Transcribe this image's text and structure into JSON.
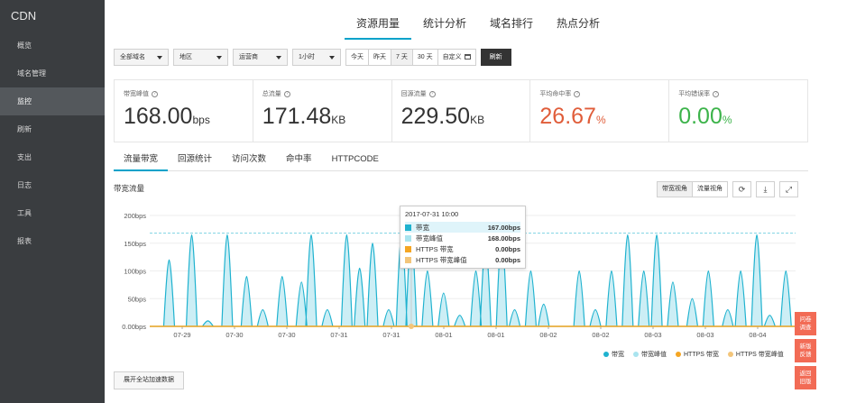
{
  "sidebar": {
    "title": "CDN",
    "items": [
      {
        "label": "概览"
      },
      {
        "label": "域名管理"
      },
      {
        "label": "监控"
      },
      {
        "label": "刷新"
      },
      {
        "label": "支出"
      },
      {
        "label": "日志"
      },
      {
        "label": "工具"
      },
      {
        "label": "报表"
      }
    ]
  },
  "topnav": [
    "资源用量",
    "统计分析",
    "域名排行",
    "热点分析"
  ],
  "filters": {
    "domain": "全部域名",
    "region": "地区",
    "isp": "运营商",
    "interval": "1小时",
    "ranges": [
      "今天",
      "昨天",
      "7 天",
      "30 天",
      "自定义"
    ],
    "refresh": "刷新"
  },
  "stats": [
    {
      "label": "带宽峰值",
      "value": "168.00",
      "unit": "bps"
    },
    {
      "label": "总流量",
      "value": "171.48",
      "unit": "KB"
    },
    {
      "label": "回源流量",
      "value": "229.50",
      "unit": "KB"
    },
    {
      "label": "平均命中率",
      "value": "26.67",
      "unit": "%"
    },
    {
      "label": "平均错误率",
      "value": "0.00",
      "unit": "%"
    }
  ],
  "subtabs": [
    "流量带宽",
    "回源统计",
    "访问次数",
    "命中率",
    "HTTPCODE"
  ],
  "chart_title": "带宽流量",
  "view_buttons": [
    "带宽视角",
    "流量视角"
  ],
  "icon_buttons": [
    "refresh-icon",
    "download-icon",
    "fullscreen-icon"
  ],
  "tooltip": {
    "time": "2017-07-31 10:00",
    "rows": [
      {
        "name": "带宽",
        "value": "167.00bps",
        "color": "#1fb2cf"
      },
      {
        "name": "带宽峰值",
        "value": "168.00bps",
        "color": "#a9e4ef"
      },
      {
        "name": "HTTPS 带宽",
        "value": "0.00bps",
        "color": "#f5a623"
      },
      {
        "name": "HTTPS 带宽峰值",
        "value": "0.00bps",
        "color": "#f3c57a"
      }
    ]
  },
  "expand_button": "展开全站加速数据",
  "side_buttons": [
    {
      "line1": "问卷",
      "line2": "调查"
    },
    {
      "line1": "新版",
      "line2": "反馈"
    },
    {
      "line1": "返回",
      "line2": "旧版"
    }
  ],
  "chart_data": {
    "type": "area",
    "y_ticks": [
      "200bps",
      "150bps",
      "100bps",
      "50bps",
      "0.00bps"
    ],
    "ylim": [
      0,
      200
    ],
    "x_ticks": [
      "07-29",
      "07-30",
      "07-30",
      "07-31",
      "07-31",
      "08-01",
      "08-01",
      "08-02",
      "08-02",
      "08-03",
      "08-03",
      "08-04"
    ],
    "series": [
      {
        "name": "带宽",
        "color": "#1fb2cf",
        "values": [
          0,
          0,
          0,
          0,
          0,
          0,
          0,
          0,
          0,
          0,
          0,
          0,
          0,
          10,
          165,
          20,
          0,
          0,
          0,
          0,
          0,
          0,
          166,
          35,
          0,
          0,
          0,
          0,
          0,
          0,
          20,
          0,
          0,
          0,
          0,
          0,
          0,
          0,
          0,
          0,
          0,
          0,
          0,
          0,
          95,
          0,
          0,
          0,
          0,
          0,
          0,
          30,
          0,
          0,
          0,
          0,
          0,
          0,
          0,
          0,
          0,
          0,
          0,
          0,
          0,
          0,
          0,
          0,
          0,
          0,
          0,
          0,
          165,
          20,
          0,
          0,
          0,
          0,
          0,
          0,
          0,
          0,
          0,
          0,
          0,
          0,
          0,
          0,
          0,
          0,
          55,
          0,
          0,
          0,
          0,
          0,
          0,
          0,
          0,
          0,
          0,
          0,
          0,
          0,
          0,
          0,
          0,
          0,
          0,
          0,
          0,
          0,
          0,
          0,
          0,
          0,
          0,
          0,
          0,
          0,
          0,
          0,
          0,
          0,
          0,
          0,
          0,
          0,
          0,
          0,
          0,
          0,
          0,
          0,
          0,
          0,
          0,
          0,
          0,
          0,
          0,
          0,
          0,
          0,
          0,
          0,
          0,
          0,
          0,
          0,
          0,
          0,
          0,
          0,
          0,
          0,
          0,
          0,
          0,
          0,
          0,
          0,
          0,
          0,
          0,
          0,
          0,
          0,
          0,
          0,
          0,
          0,
          0,
          0,
          0,
          0,
          0,
          0,
          0,
          0,
          0,
          0,
          0,
          0,
          0,
          0,
          0,
          0,
          0,
          0,
          0,
          0,
          0,
          0,
          0,
          0,
          0,
          0,
          0,
          0,
          0,
          0,
          0,
          0,
          0,
          0,
          0,
          0,
          0,
          0,
          0,
          0,
          0,
          0,
          0,
          0,
          0,
          0,
          0,
          0,
          0,
          0,
          0,
          0,
          0,
          0,
          0,
          0,
          0,
          0,
          0,
          0,
          0,
          0,
          0
        ]
      },
      {
        "name": "带宽峰值",
        "color": "#a9e4ef",
        "values": []
      },
      {
        "name": "HTTPS 带宽",
        "color": "#f5a623",
        "values": []
      },
      {
        "name": "HTTPS 带宽峰值",
        "color": "#f3c57a",
        "values": []
      }
    ],
    "peaks": [
      {
        "x": 0.03,
        "y": 120
      },
      {
        "x": 0.065,
        "y": 165
      },
      {
        "x": 0.09,
        "y": 10
      },
      {
        "x": 0.12,
        "y": 165
      },
      {
        "x": 0.15,
        "y": 90
      },
      {
        "x": 0.175,
        "y": 30
      },
      {
        "x": 0.205,
        "y": 90
      },
      {
        "x": 0.235,
        "y": 80
      },
      {
        "x": 0.25,
        "y": 165
      },
      {
        "x": 0.275,
        "y": 30
      },
      {
        "x": 0.305,
        "y": 165
      },
      {
        "x": 0.325,
        "y": 105
      },
      {
        "x": 0.345,
        "y": 150
      },
      {
        "x": 0.37,
        "y": 30
      },
      {
        "x": 0.39,
        "y": 165
      },
      {
        "x": 0.405,
        "y": 165
      },
      {
        "x": 0.43,
        "y": 100
      },
      {
        "x": 0.455,
        "y": 60
      },
      {
        "x": 0.48,
        "y": 20
      },
      {
        "x": 0.505,
        "y": 100
      },
      {
        "x": 0.52,
        "y": 150
      },
      {
        "x": 0.545,
        "y": 165
      },
      {
        "x": 0.565,
        "y": 30
      },
      {
        "x": 0.59,
        "y": 100
      },
      {
        "x": 0.61,
        "y": 40
      },
      {
        "x": 0.665,
        "y": 100
      },
      {
        "x": 0.69,
        "y": 30
      },
      {
        "x": 0.715,
        "y": 100
      },
      {
        "x": 0.74,
        "y": 165
      },
      {
        "x": 0.765,
        "y": 100
      },
      {
        "x": 0.785,
        "y": 165
      },
      {
        "x": 0.81,
        "y": 80
      },
      {
        "x": 0.84,
        "y": 50
      },
      {
        "x": 0.865,
        "y": 100
      },
      {
        "x": 0.895,
        "y": 30
      },
      {
        "x": 0.915,
        "y": 100
      },
      {
        "x": 0.94,
        "y": 165
      },
      {
        "x": 0.96,
        "y": 20
      },
      {
        "x": 0.985,
        "y": 100
      }
    ],
    "peak_line": 168
  },
  "legend": [
    "带宽",
    "带宽峰值",
    "HTTPS 带宽",
    "HTTPS 带宽峰值"
  ]
}
